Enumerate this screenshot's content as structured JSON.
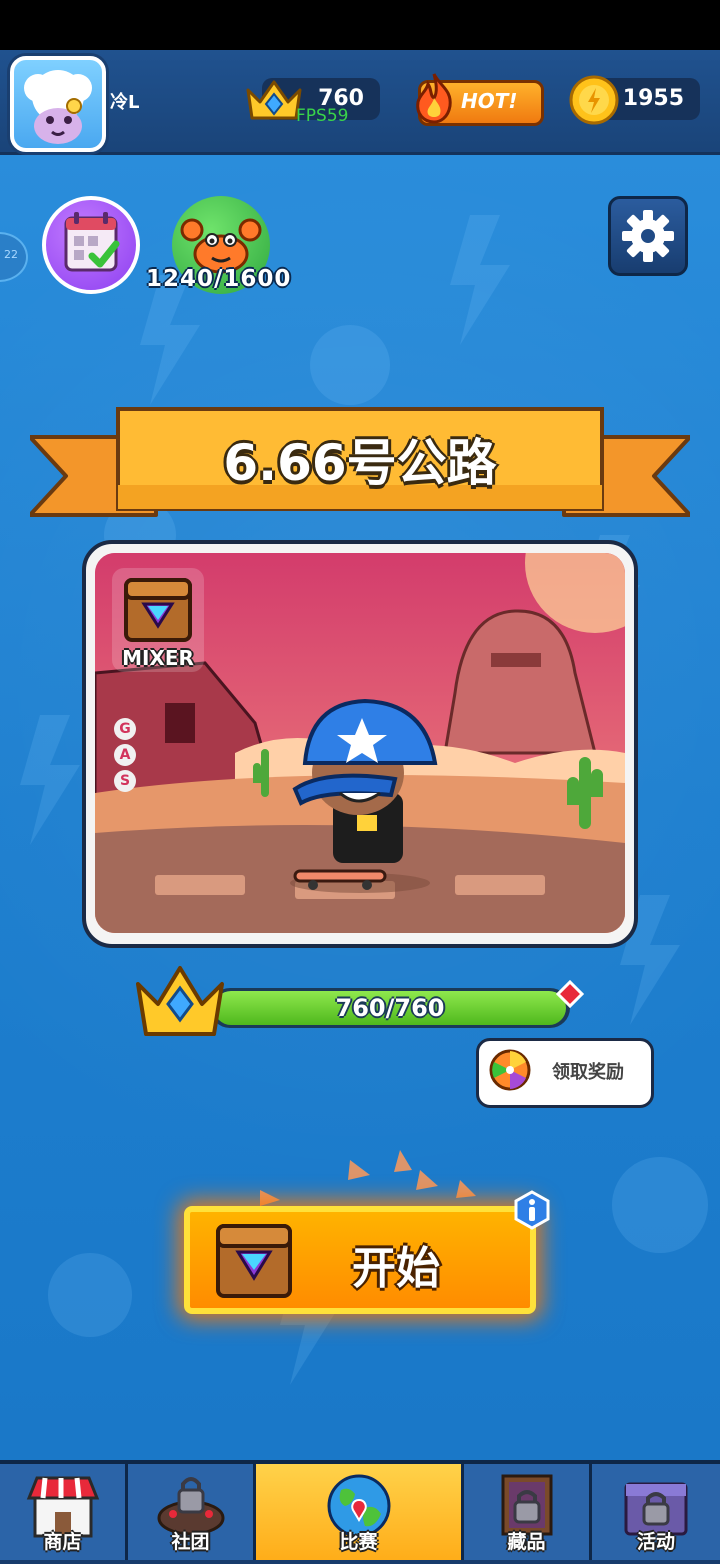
{
  "header": {
    "player_name": "冷L",
    "trophies": "760",
    "fps": "FPS59",
    "hot_label": "HOT!",
    "coins": "1955"
  },
  "quick": {
    "crab_progress": "1240/1600",
    "side_tab_text": "22"
  },
  "track": {
    "title": "6.66号公路",
    "mode_label": "MIXER",
    "side_letters": [
      "G",
      "A",
      "S"
    ]
  },
  "progress": {
    "text": "760/760",
    "fraction": 1.0
  },
  "reward": {
    "label": "领取奖励"
  },
  "start": {
    "label": "开始"
  },
  "nav": {
    "items": [
      {
        "label": "商店",
        "icon": "shop-icon",
        "active": false,
        "locked": false
      },
      {
        "label": "社团",
        "icon": "club-icon",
        "active": false,
        "locked": true
      },
      {
        "label": "比赛",
        "icon": "globe-icon",
        "active": true,
        "locked": false
      },
      {
        "label": "藏品",
        "icon": "collection-icon",
        "active": false,
        "locked": true
      },
      {
        "label": "活动",
        "icon": "event-icon",
        "active": false,
        "locked": true
      }
    ]
  },
  "colors": {
    "background": "#1d7fcf",
    "accent_orange": "#ff8c00",
    "ribbon": "#ffb833",
    "progress_green": "#6fd034"
  }
}
